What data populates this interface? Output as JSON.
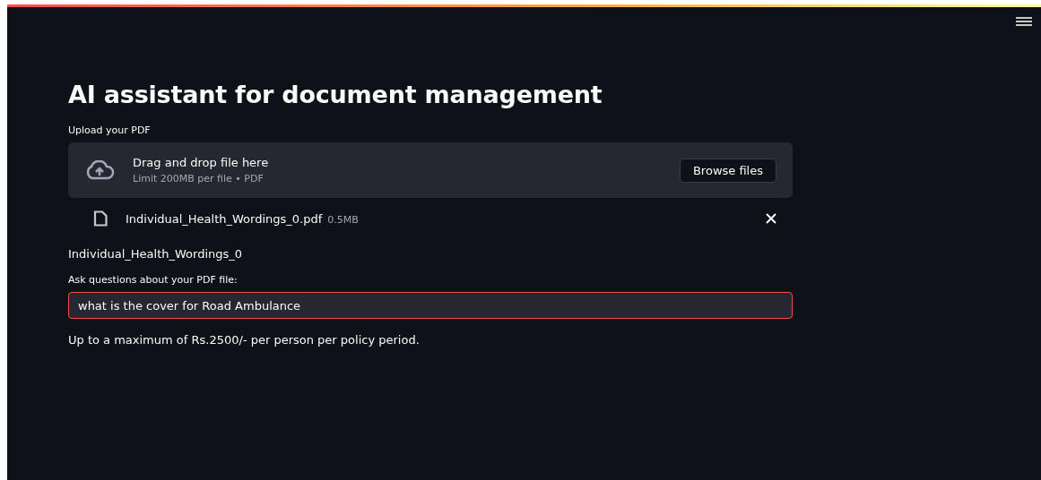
{
  "title": "AI assistant for document management",
  "uploader": {
    "label": "Upload your PDF",
    "drop_text": "Drag and drop file here",
    "limit_text": "Limit 200MB per file • PDF",
    "button": "Browse files"
  },
  "uploaded_file": {
    "name": "Individual_Health_Wordings_0.pdf",
    "size": "0.5MB"
  },
  "document_name": "Individual_Health_Wordings_0",
  "question": {
    "label": "Ask questions about your PDF file:",
    "value": "what is the cover for Road Ambulance",
    "focused": true
  },
  "answer": "Up to a maximum of Rs.2500/- per person per policy period."
}
